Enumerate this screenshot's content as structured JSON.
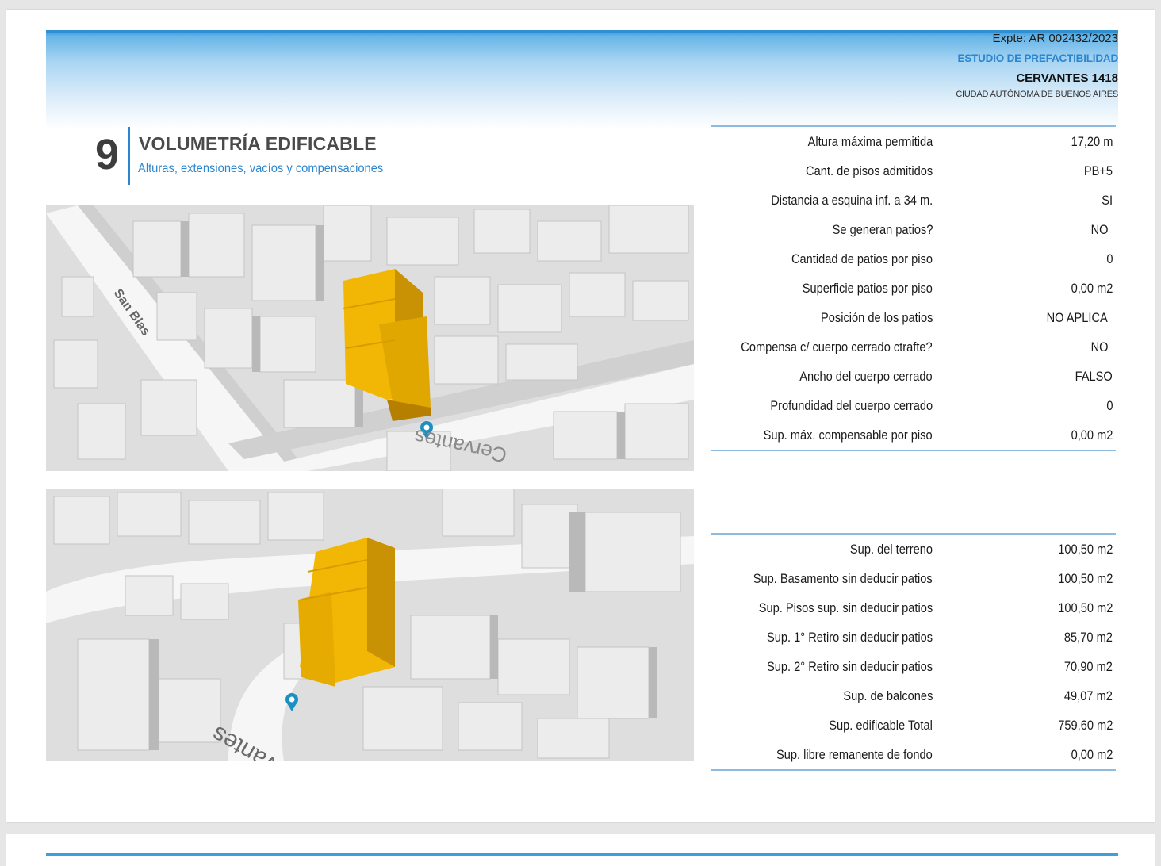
{
  "header": {
    "expte": "Expte: AR 002432/2023",
    "study": "ESTUDIO DE PREFACTIBILIDAD",
    "address": "CERVANTES 1418",
    "city": "CIUDAD AUTÓNOMA DE BUENOS AIRES"
  },
  "section": {
    "number": "9",
    "title": "VOLUMETRÍA EDIFICABLE",
    "subtitle": "Alturas, extensiones, vacíos y compensaciones"
  },
  "maps": {
    "top": {
      "street_1": "San Blas",
      "street_2": "Cervantes"
    },
    "bottom": {
      "street_1": "Cervantes"
    }
  },
  "table_1": [
    {
      "label": "Altura máxima permitida",
      "value": "17,20 m"
    },
    {
      "label": "Cant. de pisos admitidos",
      "value": "PB+5"
    },
    {
      "label": "Distancia a esquina inf. a 34 m.",
      "value": "SI"
    },
    {
      "label": "Se generan patios?",
      "value": "NO"
    },
    {
      "label": "Cantidad de patios por piso",
      "value": "0"
    },
    {
      "label": "Superficie patios por piso",
      "value": "0,00 m2"
    },
    {
      "label": "Posición de los patios",
      "value": "NO APLICA"
    },
    {
      "label": "Compensa c/ cuerpo cerrado ctrafte?",
      "value": "NO"
    },
    {
      "label": "Ancho del  cuerpo cerrado",
      "value": "FALSO"
    },
    {
      "label": "Profundidad del  cuerpo cerrado",
      "value": "0"
    },
    {
      "label": "Sup. máx. compensable por piso",
      "value": "0,00 m2"
    }
  ],
  "table_2": [
    {
      "label": "Sup. del terreno",
      "value": "100,50 m2"
    },
    {
      "label": "Sup. Basamento sin deducir patios",
      "value": "100,50 m2"
    },
    {
      "label": "Sup. Pisos sup. sin deducir patios",
      "value": "100,50 m2"
    },
    {
      "label": "Sup. 1° Retiro sin deducir patios",
      "value": "85,70 m2"
    },
    {
      "label": "Sup. 2° Retiro sin deducir patios",
      "value": "70,90 m2"
    },
    {
      "label": "Sup. de balcones",
      "value": "49,07 m2"
    },
    {
      "label": "Sup. edificable Total",
      "value": "759,60 m2"
    },
    {
      "label": "Sup. libre remanente de fondo",
      "value": "0,00 m2"
    }
  ],
  "colors": {
    "accent_blue": "#2b86cf",
    "building_highlight": "#f2b705",
    "map_background": "#e1e1e1"
  }
}
